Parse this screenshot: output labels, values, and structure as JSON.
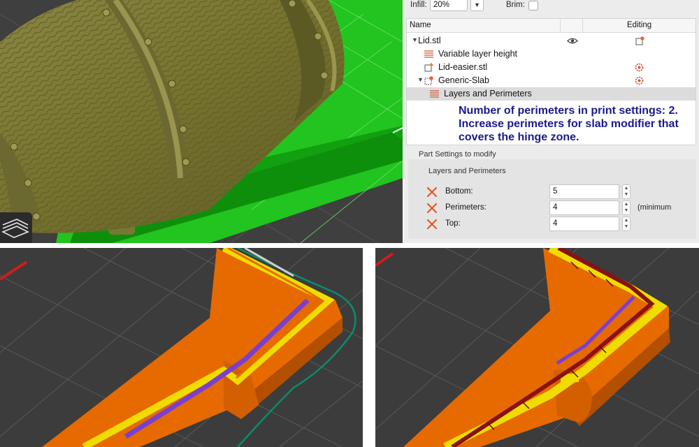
{
  "toolbar": {
    "infill_label": "Infill:",
    "infill_value": "20%",
    "brim_label": "Brim:"
  },
  "object_list": {
    "columns": {
      "name": "Name",
      "editing": "Editing"
    },
    "items": [
      {
        "label": "Lid.stl",
        "icon": "file-icon",
        "visibility_icon": "eye-icon",
        "editing_icon": "edit-object-icon"
      },
      {
        "label": "Variable layer height",
        "icon": "layer-height-icon"
      },
      {
        "label": "Lid-easier.stl",
        "icon": "add-part-icon",
        "editing_icon": "settings-gear-icon"
      },
      {
        "label": "Generic-Slab",
        "icon": "modifier-icon",
        "editing_icon": "settings-gear-icon"
      },
      {
        "label": "Layers and Perimeters",
        "icon": "layers-icon",
        "selected": true
      }
    ]
  },
  "annotation": {
    "line1": "Number of perimeters in print settings: 2.",
    "line2": "Increase perimeters for slab modifier that",
    "line3": "covers the hinge zone."
  },
  "part_settings": {
    "title": "Part Settings to modify",
    "group_title": "Layers and Perimeters",
    "rows": [
      {
        "label": "Bottom:",
        "value": "5"
      },
      {
        "label": "Perimeters:",
        "value": "4",
        "unit": "(minimum"
      },
      {
        "label": "Top:",
        "value": "4"
      }
    ]
  },
  "colors": {
    "bed_green": "#1fcf1f",
    "model_olive": "#7d7a3a",
    "extrusion_orange": "#e66a00",
    "infill_purple": "#7b3fd0",
    "perimeter_yellow": "#e8d800",
    "travel_teal": "#0a8c6a",
    "annotation_navy": "#1a1a8c",
    "delete_red": "#e05a2a"
  }
}
